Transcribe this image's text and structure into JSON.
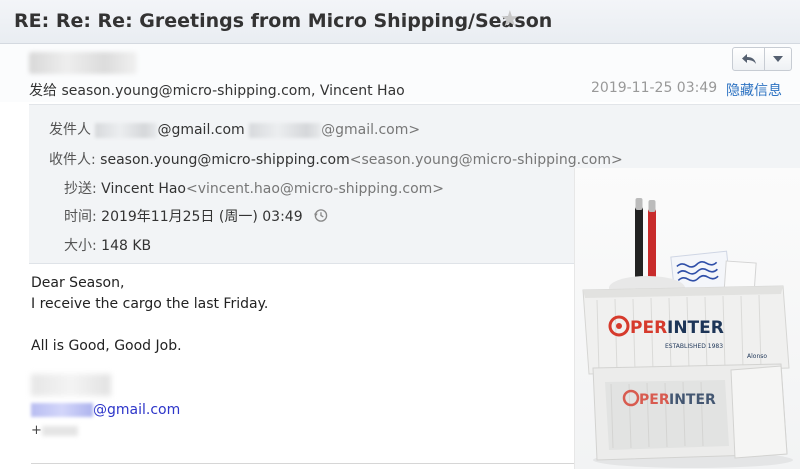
{
  "email": {
    "subject": "RE: Re: Re: Greetings from Micro Shipping/Season",
    "to_label": "发给",
    "to_value": "season.young@micro-shipping.com, Vincent Hao",
    "date": "2019-11-25 03:49",
    "hide_details": "隐藏信息",
    "details": {
      "from_label": "发件人",
      "from_domain": "@gmail.com",
      "from_domain_bracket": "@gmail.com>",
      "recipient_label": "收件人:",
      "recipient_name": "season.young@micro-shipping.com",
      "recipient_addr": "<season.young@micro-shipping.com>",
      "cc_label": "抄送:",
      "cc_name": "Vincent Hao",
      "cc_addr": "<vincent.hao@micro-shipping.com>",
      "time_label": "时间:",
      "time_value": "2019年11月25日 (周一) 03:49",
      "size_label": "大小:",
      "size_value": "148 KB"
    },
    "body": {
      "greeting": "Dear Season,",
      "line1": "I receive the cargo the last Friday.",
      "line2": "All is Good, Good Job.",
      "sig_email_domain": "@gmail.com",
      "sig_phone_prefix": "+"
    }
  },
  "photo": {
    "brand_text_1": "OPERINTER",
    "brand_subtext": "ESTABLISHED 1983",
    "corner_text": "Alonso",
    "colors": {
      "brand_red": "#d63a2c",
      "brand_navy": "#1d3557"
    }
  },
  "icons": {
    "star": "star-icon",
    "reply": "reply-icon",
    "dropdown": "chevron-down-icon",
    "history": "history-icon"
  }
}
